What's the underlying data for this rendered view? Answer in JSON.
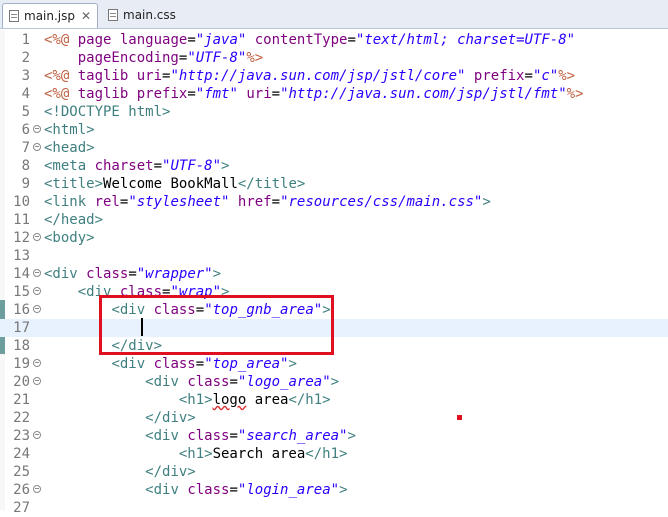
{
  "tabs": [
    {
      "label": "main.jsp",
      "close": "✕"
    },
    {
      "label": "main.css"
    }
  ],
  "colors": {
    "annotation": "#e01020",
    "directive": "#bf5f3f",
    "tag": "#3f7f7f",
    "attr": "#7f007f",
    "value": "#2a00ff"
  },
  "lines": [
    {
      "n": "1",
      "tokens": [
        [
          "dir",
          "<%@ "
        ],
        [
          "attr",
          "page "
        ],
        [
          "attr",
          "language"
        ],
        [
          "txt",
          "="
        ],
        [
          "val",
          "\"java\""
        ],
        [
          "attr",
          " contentType"
        ],
        [
          "txt",
          "="
        ],
        [
          "val",
          "\"text/html; charset=UTF-8\""
        ]
      ]
    },
    {
      "n": "2",
      "tokens": [
        [
          "txt",
          "    "
        ],
        [
          "attr",
          "pageEncoding"
        ],
        [
          "txt",
          "="
        ],
        [
          "val",
          "\"UTF-8\""
        ],
        [
          "dir",
          "%>"
        ]
      ]
    },
    {
      "n": "3",
      "tokens": [
        [
          "dir",
          "<%@ "
        ],
        [
          "attr",
          "taglib "
        ],
        [
          "attr",
          "uri"
        ],
        [
          "txt",
          "="
        ],
        [
          "val",
          "\"http://java.sun.com/jsp/jstl/core\""
        ],
        [
          "attr",
          " prefix"
        ],
        [
          "txt",
          "="
        ],
        [
          "val",
          "\"c\""
        ],
        [
          "dir",
          "%>"
        ]
      ]
    },
    {
      "n": "4",
      "tokens": [
        [
          "dir",
          "<%@ "
        ],
        [
          "attr",
          "taglib "
        ],
        [
          "attr",
          "prefix"
        ],
        [
          "txt",
          "="
        ],
        [
          "val",
          "\"fmt\""
        ],
        [
          "attr",
          " uri"
        ],
        [
          "txt",
          "="
        ],
        [
          "val",
          "\"http://java.sun.com/jsp/jstl/fmt\""
        ],
        [
          "dir",
          "%>"
        ]
      ]
    },
    {
      "n": "5",
      "tokens": [
        [
          "tag",
          "<!DOCTYPE html>"
        ]
      ]
    },
    {
      "n": "6",
      "fold": true,
      "tokens": [
        [
          "tag",
          "<html>"
        ]
      ]
    },
    {
      "n": "7",
      "fold": true,
      "tokens": [
        [
          "tag",
          "<head>"
        ]
      ]
    },
    {
      "n": "8",
      "tokens": [
        [
          "tag",
          "<meta "
        ],
        [
          "attr",
          "charset"
        ],
        [
          "txt",
          "="
        ],
        [
          "val",
          "\"UTF-8\""
        ],
        [
          "tag",
          ">"
        ]
      ]
    },
    {
      "n": "9",
      "tokens": [
        [
          "tag",
          "<title>"
        ],
        [
          "txt",
          "Welcome BookMall"
        ],
        [
          "tag",
          "</title>"
        ]
      ]
    },
    {
      "n": "10",
      "tokens": [
        [
          "tag",
          "<link "
        ],
        [
          "attr",
          "rel"
        ],
        [
          "txt",
          "="
        ],
        [
          "val",
          "\"stylesheet\""
        ],
        [
          "attr",
          " href"
        ],
        [
          "txt",
          "="
        ],
        [
          "val",
          "\"resources/css/main.css\""
        ],
        [
          "tag",
          ">"
        ]
      ]
    },
    {
      "n": "11",
      "tokens": [
        [
          "tag",
          "</head>"
        ]
      ]
    },
    {
      "n": "12",
      "fold": true,
      "tokens": [
        [
          "tag",
          "<body>"
        ]
      ]
    },
    {
      "n": "13",
      "tokens": []
    },
    {
      "n": "14",
      "fold": true,
      "tokens": [
        [
          "tag",
          "<div "
        ],
        [
          "attr",
          "class"
        ],
        [
          "txt",
          "="
        ],
        [
          "val",
          "\"wrapper\""
        ],
        [
          "tag",
          ">"
        ]
      ]
    },
    {
      "n": "15",
      "fold": true,
      "tokens": [
        [
          "txt",
          "    "
        ],
        [
          "tag",
          "<div "
        ],
        [
          "attr",
          "class"
        ],
        [
          "txt",
          "="
        ],
        [
          "val",
          "\"wrap\""
        ],
        [
          "tag",
          ">"
        ]
      ]
    },
    {
      "n": "16",
      "fold": true,
      "tokens": [
        [
          "txt",
          "        "
        ],
        [
          "tag",
          "<div "
        ],
        [
          "attr",
          "class"
        ],
        [
          "txt",
          "="
        ],
        [
          "val",
          "\"top_gnb_area\""
        ],
        [
          "tag",
          ">"
        ]
      ]
    },
    {
      "n": "17",
      "tokens": [
        [
          "txt",
          "            "
        ]
      ]
    },
    {
      "n": "18",
      "tokens": [
        [
          "txt",
          "        "
        ],
        [
          "tag",
          "</div>"
        ]
      ]
    },
    {
      "n": "19",
      "fold": true,
      "tokens": [
        [
          "txt",
          "        "
        ],
        [
          "tag",
          "<div "
        ],
        [
          "attr",
          "class"
        ],
        [
          "txt",
          "="
        ],
        [
          "val",
          "\"top_area\""
        ],
        [
          "tag",
          ">"
        ]
      ]
    },
    {
      "n": "20",
      "fold": true,
      "tokens": [
        [
          "txt",
          "            "
        ],
        [
          "tag",
          "<div "
        ],
        [
          "attr",
          "class"
        ],
        [
          "txt",
          "="
        ],
        [
          "val",
          "\"logo_area\""
        ],
        [
          "tag",
          ">"
        ]
      ]
    },
    {
      "n": "21",
      "tokens": [
        [
          "txt",
          "                "
        ],
        [
          "tag",
          "<h1>"
        ],
        [
          "sq",
          "logo"
        ],
        [
          "txt",
          " area"
        ],
        [
          "tag",
          "</h1>"
        ]
      ]
    },
    {
      "n": "22",
      "tokens": [
        [
          "txt",
          "            "
        ],
        [
          "tag",
          "</div>"
        ]
      ]
    },
    {
      "n": "23",
      "fold": true,
      "tokens": [
        [
          "txt",
          "            "
        ],
        [
          "tag",
          "<div "
        ],
        [
          "attr",
          "class"
        ],
        [
          "txt",
          "="
        ],
        [
          "val",
          "\"search_area\""
        ],
        [
          "tag",
          ">"
        ]
      ]
    },
    {
      "n": "24",
      "tokens": [
        [
          "txt",
          "                "
        ],
        [
          "tag",
          "<h1>"
        ],
        [
          "txt",
          "Search area"
        ],
        [
          "tag",
          "</h1>"
        ]
      ]
    },
    {
      "n": "25",
      "tokens": [
        [
          "txt",
          "            "
        ],
        [
          "tag",
          "</div>"
        ]
      ]
    },
    {
      "n": "26",
      "fold": true,
      "tokens": [
        [
          "txt",
          "            "
        ],
        [
          "tag",
          "<div "
        ],
        [
          "attr",
          "class"
        ],
        [
          "txt",
          "="
        ],
        [
          "val",
          "\"login_area\""
        ],
        [
          "tag",
          ">"
        ]
      ]
    },
    {
      "n": "27",
      "tokens": []
    }
  ]
}
